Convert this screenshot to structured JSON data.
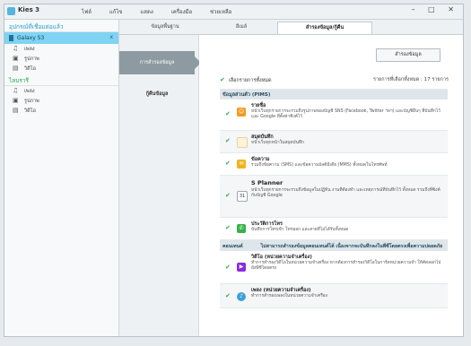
{
  "app": {
    "title": "Kies 3",
    "menu": [
      "ไฟล์",
      "แก้ไข",
      "แสดง",
      "เครื่องมือ",
      "ช่วยเหลือ"
    ],
    "window_controls": "– □ ✕"
  },
  "sidebar": {
    "connected_title": "อุปกรณ์ที่เชื่อมต่อแล้ว",
    "device": "Galaxy S3",
    "device_close": "x",
    "device_items": [
      {
        "icon": "music-icon",
        "glyph": "♫",
        "label": "เพลง"
      },
      {
        "icon": "photo-icon",
        "glyph": "▣",
        "label": "รูปภาพ"
      },
      {
        "icon": "video-icon",
        "glyph": "▤",
        "label": "วิดีโอ"
      }
    ],
    "library_title": "ไลบรารี",
    "library_items": [
      {
        "icon": "music-icon",
        "glyph": "♫",
        "label": "เพลง"
      },
      {
        "icon": "photo-icon",
        "glyph": "▣",
        "label": "รูปภาพ"
      },
      {
        "icon": "video-icon",
        "glyph": "▤",
        "label": "วิดีโอ"
      }
    ]
  },
  "tabs": [
    {
      "label": "ข้อมูลพื้นฐาน",
      "active": false
    },
    {
      "label": "อีเมล์",
      "active": false
    },
    {
      "label": "สำรองข้อมูล/กู้คืน",
      "active": true
    }
  ],
  "leftnav": {
    "active": "การสำรองข้อมูล",
    "item": "กู้คืนข้อมูล"
  },
  "main": {
    "backup_button": "สำรองข้อมูล",
    "select_all": "เลือกรายการทั้งหมด",
    "total": "รายการที่เลือกทั้งหมด : 17 รายการ",
    "category1": "ข้อมูลส่วนตัว (PIMS)",
    "category2_left": "คอนเทนต์",
    "category2_right": "ไม่สามารถสำรองข้อมูลคอนเทนต์ได้ เนื่องจากจะบันทึกลงในพีซีโดยตรงเพื่อความปลอดภัย",
    "items": [
      {
        "icon": "contacts-icon",
        "color": "#f39a1f",
        "glyph": "☺",
        "title": "รายชื่อ",
        "desc": "หน้าเว็บทุกรายการจะรวมถึงรูปภาพของบัญชี SNS (Facebook, Twitter ฯลฯ) และบัญชีอื่นๆ ที่บันทึกไว้ และ Google ที่ตั้งค่าซิงค์ไว้"
      },
      {
        "icon": "memo-icon",
        "color": "#fff3d6",
        "glyph": "",
        "title": "สมุดบันทึก",
        "desc": "หน้าเว็บทุกหน้าในสมุดบันทึก"
      },
      {
        "icon": "message-icon",
        "color": "#f0b21c",
        "glyph": "✉",
        "title": "ข้อความ",
        "desc": "รวมถึงข้อความ (SMS) และข้อความมัลติมีเดีย (MMS) ทั้งหมดในโทรศัพท์"
      },
      {
        "icon": "splanner-icon",
        "color": "#ffffff",
        "glyph": "31",
        "title": "S Planner",
        "desc": "หน้าเว็บทุกรายการจะรวมถึงข้อมูลในปฏิทิน งานที่ต้องทำ และเหตุการณ์ที่บันทึกไว้ ทั้งหมด รวมถึงที่ซิงค์กับบัญชี Google"
      },
      {
        "icon": "call-log-icon",
        "color": "#35b24a",
        "glyph": "✆",
        "title": "ประวัติการโทร",
        "desc": "บันทึกการโทรเข้า โทรออก และสายที่ไม่ได้รับทั้งหมด"
      }
    ],
    "content_items": [
      {
        "icon": "video-play-icon",
        "color": "#8a2be2",
        "glyph": "▶",
        "title": "วิดีโอ (หน่วยความจำเครื่อง)",
        "desc": "ทำการสำรองวิดีโอในหน่วยความจำเครื่อง หากต้องการสำรองวิดีโอในการ์ดหน่วยความจำ ให้คัดลอกไปยังพีซีโดยตรง"
      },
      {
        "icon": "music-note-icon",
        "color": "#3fa0d8",
        "glyph": "♪",
        "title": "เพลง (หน่วยความจำเครื่อง)",
        "desc": "ทำการสำรองเพลงในหน่วยความจำเครื่อง"
      }
    ]
  }
}
